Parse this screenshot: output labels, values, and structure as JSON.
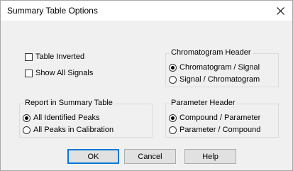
{
  "window": {
    "title": "Summary Table Options"
  },
  "options": {
    "table_inverted": {
      "label": "Table Inverted",
      "checked": false
    },
    "show_all_signals": {
      "label": "Show All Signals",
      "checked": false
    }
  },
  "chromatogram_header": {
    "title": "Chromatogram Header",
    "options": [
      "Chromatogram / Signal",
      "Signal / Chromatogram"
    ],
    "selected": "Chromatogram / Signal"
  },
  "report": {
    "title": "Report in Summary Table",
    "options": [
      "All Identified Peaks",
      "All Peaks in Calibration"
    ],
    "selected": "All Identified Peaks"
  },
  "parameter_header": {
    "title": "Parameter Header",
    "options": [
      "Compound / Parameter",
      "Parameter / Compound"
    ],
    "selected": "Compound / Parameter"
  },
  "buttons": {
    "ok": "OK",
    "cancel": "Cancel",
    "help": "Help"
  },
  "icons": {
    "close": "close-icon"
  }
}
